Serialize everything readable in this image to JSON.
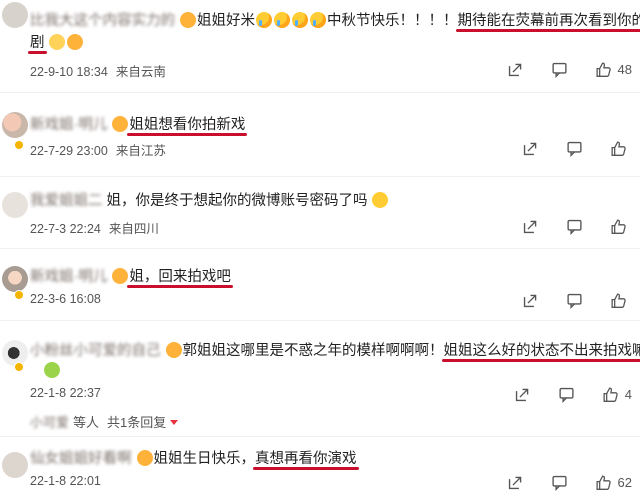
{
  "comments": [
    {
      "user": "比我大这个内容实力的",
      "text_a": "姐姐好米",
      "text_b": "中秋节快乐！！！！",
      "text_hl": "期待能在荧幕前再次看到你的",
      "text_c": "剧",
      "date": "22-9-10 18:34",
      "location": "来自云南",
      "likes": "48"
    },
    {
      "user": "新戏姐·明儿",
      "text_hl": "姐姐想看你拍新戏",
      "date": "22-7-29 23:00",
      "location": "来自江苏",
      "likes": ""
    },
    {
      "user": "我爱姐姐二",
      "text_a": "姐，你是终于想起你的微博账号密码了吗",
      "date": "22-7-3 22:24",
      "location": "来自四川",
      "likes": ""
    },
    {
      "user": "新戏姐·明儿",
      "text_hl": "姐，回来拍戏吧",
      "date": "22-3-6 16:08",
      "location": "",
      "likes": ""
    },
    {
      "user": "小粉丝小可爱的自己",
      "text_a": "郭姐姐这哪里是不惑之年的模样啊啊啊！",
      "text_hl": "姐姐这么好的状态不出来拍戏嘛",
      "date": "22-1-8 22:37",
      "location": "",
      "likes": "4"
    },
    {
      "user": "仙女姐姐好看啊",
      "text_a": "姐姐生日快乐，",
      "text_hl": "真想再看你演戏",
      "date": "22-1-8 22:01",
      "location": "",
      "likes": "62"
    }
  ],
  "reply_summary": {
    "users": "等人",
    "count_label": "共1条回复"
  },
  "icons": [
    "share-icon",
    "comment-icon",
    "like-icon"
  ],
  "colors": {
    "highlight": "#c8102e",
    "meta": "#555555"
  }
}
